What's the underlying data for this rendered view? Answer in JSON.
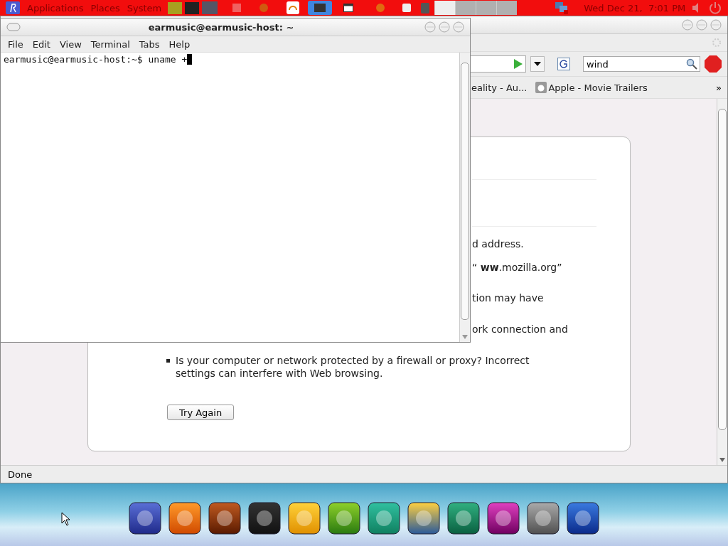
{
  "top_panel": {
    "menus": [
      "Applications",
      "Places",
      "System"
    ],
    "clock": "Wed Dec 21,  7:01 PM"
  },
  "browser": {
    "search": {
      "value": "wind"
    },
    "bookmarks": [
      "eality - Au...",
      "Apple - Movie Trailers"
    ],
    "bookmarks_overflow": "»",
    "error_lines": [
      "d address.",
      "“ **ww**.mozilla.org”",
      "tion may have",
      "ork connection and"
    ],
    "bullet": "Is your computer or network protected by a firewall or proxy? Incorrect settings can interfere with Web browsing.",
    "button": "Try Again",
    "status": "Done"
  },
  "terminal": {
    "title": "earmusic@earmusic-host: ~",
    "menu": [
      "File",
      "Edit",
      "View",
      "Terminal",
      "Tabs",
      "Help"
    ],
    "lines": [
      "earmusic@earmusic-host:~$ uname +"
    ]
  }
}
